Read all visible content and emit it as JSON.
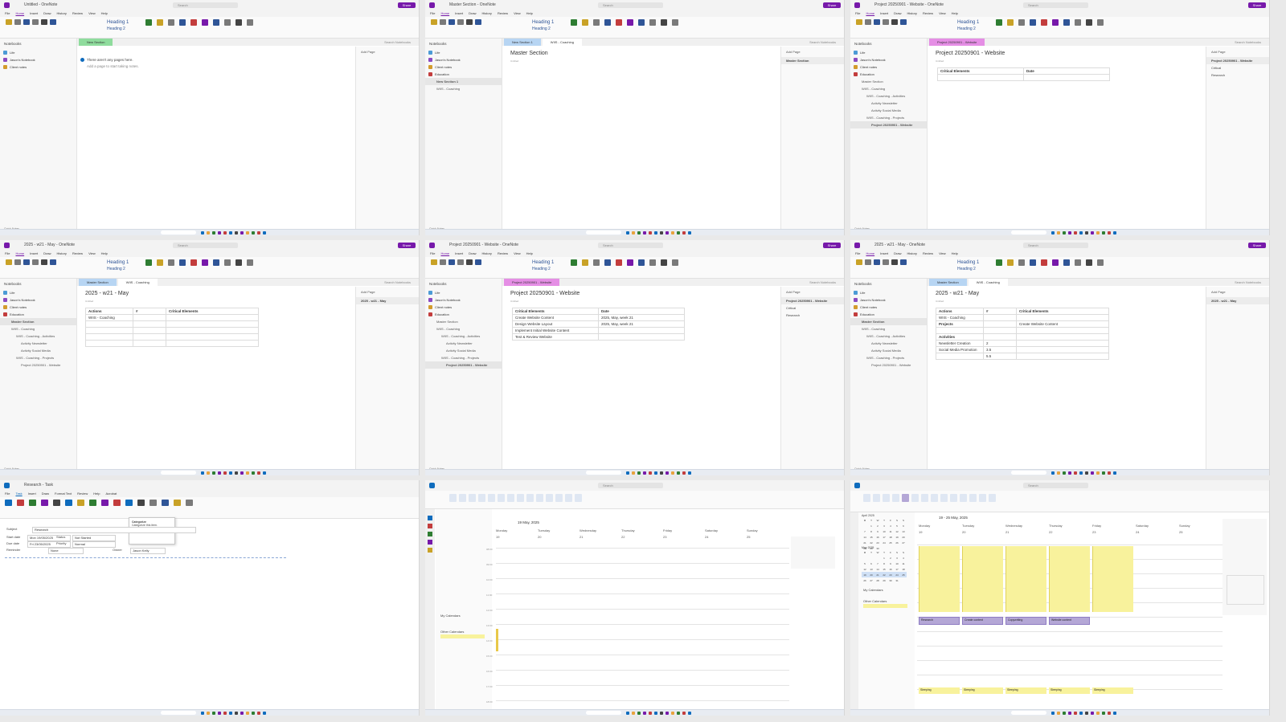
{
  "brand": {
    "onenote_purple": "#7719aa",
    "outlook_blue": "#0f6cbd",
    "event_yellow": "#f8f29c",
    "event_purple": "#b4a7d6",
    "page_tab_pink": "#e58ee5",
    "section_tab_blue": "#b7d5f3",
    "section_tab_green": "#8fdc9d"
  },
  "panels": [
    {
      "window_title": "Untitled - OneNote",
      "search": "Search",
      "share": "Share",
      "menus": [
        "File",
        "Home",
        "Insert",
        "Draw",
        "History",
        "Review",
        "View",
        "Help"
      ],
      "active_menu": "Home",
      "ribbon": {
        "heading1": "Heading 1",
        "heading2": "Heading 2"
      },
      "notebooks_header": "Notebooks",
      "notebooks": [
        {
          "label": "Life",
          "color": "#4c9bd6"
        },
        {
          "label": "Jason's Notebook",
          "color": "#8a4ac2"
        },
        {
          "label": "Client notes",
          "color": "#d39b2c"
        }
      ],
      "tabs": [
        {
          "label": "New Section",
          "color": "#8fdc9d"
        }
      ],
      "search_sections": "Search Notebooks",
      "note_line1": "There aren't any pages here.",
      "note_line2": "Add a page to start taking notes.",
      "add_page": "Add Page",
      "footer": "Quick Notes"
    },
    {
      "window_title": "Master Section - OneNote",
      "search": "Search",
      "share": "Share",
      "menus": [
        "File",
        "Home",
        "Insert",
        "Draw",
        "History",
        "Review",
        "View",
        "Help"
      ],
      "active_menu": "Home",
      "ribbon": {
        "heading1": "Heading 1",
        "heading2": "Heading 2"
      },
      "notebooks_header": "Notebooks",
      "notebooks": [
        {
          "label": "Life",
          "color": "#4c9bd6"
        },
        {
          "label": "Jason's Notebook",
          "color": "#8a4ac2"
        },
        {
          "label": "Client notes",
          "color": "#d39b2c"
        },
        {
          "label": "Education",
          "color": "#c33d3d"
        }
      ],
      "sections": [
        {
          "label": "New Section 1",
          "level": 1,
          "selected": true
        },
        {
          "label": "WIIS - Coaching",
          "level": 1,
          "selected": false
        }
      ],
      "tabs": [
        {
          "label": "New Section 1",
          "color": "#b7d5f3"
        },
        {
          "label": "WIIS - Coaching",
          "color": "#ffffff"
        }
      ],
      "search_sections": "Search Notebooks",
      "page_title": "Master Section",
      "page_date": "Untitled",
      "add_page": "Add Page",
      "pages": [
        "Master Section"
      ],
      "footer": "Quick Notes"
    },
    {
      "window_title": "Project 20250901 - Website - OneNote",
      "search": "Search",
      "share": "Share",
      "menus": [
        "File",
        "Home",
        "Insert",
        "Draw",
        "History",
        "Review",
        "View",
        "Help"
      ],
      "active_menu": "Home",
      "ribbon": {
        "heading1": "Heading 1",
        "heading2": "Heading 2"
      },
      "notebooks_header": "Notebooks",
      "notebooks": [
        {
          "label": "Life",
          "color": "#4c9bd6"
        },
        {
          "label": "Jason's Notebook",
          "color": "#8a4ac2"
        },
        {
          "label": "Client notes",
          "color": "#d39b2c"
        },
        {
          "label": "Education",
          "color": "#c33d3d"
        }
      ],
      "sections": [
        {
          "label": "Master Section",
          "level": 1,
          "selected": false
        },
        {
          "label": "WIIS - Coaching",
          "level": 1,
          "selected": false
        },
        {
          "label": "WIIS - Coaching - Activities",
          "level": 2,
          "selected": false
        },
        {
          "label": "Activity Newsletter",
          "level": 3,
          "selected": false
        },
        {
          "label": "Activity Social Media",
          "level": 3,
          "selected": false
        },
        {
          "label": "WIIS - Coaching - Projects",
          "level": 2,
          "selected": false
        },
        {
          "label": "Project 20250901 - Website",
          "level": 3,
          "selected": true
        }
      ],
      "tabs": [
        {
          "label": "Project 20250901 - Website",
          "color": "#e58ee5"
        }
      ],
      "search_sections": "Search Notebooks",
      "page_title": "Project 20250901 - Website",
      "page_date": "Untitled",
      "table": [
        [
          "Critical Elements",
          "Date"
        ],
        [
          "",
          ""
        ]
      ],
      "add_page": "Add Page",
      "pages": [
        "Project 20250901 - Website",
        "Critical",
        "Research"
      ],
      "footer": "Quick Notes"
    },
    {
      "window_title": "2025 - w21 - May - OneNote",
      "search": "Search",
      "share": "Share",
      "menus": [
        "File",
        "Home",
        "Insert",
        "Draw",
        "History",
        "Review",
        "View",
        "Help"
      ],
      "active_menu": "Home",
      "ribbon": {
        "heading1": "Heading 1",
        "heading2": "Heading 2"
      },
      "notebooks_header": "Notebooks",
      "notebooks": [
        {
          "label": "Life",
          "color": "#4c9bd6"
        },
        {
          "label": "Jason's Notebook",
          "color": "#8a4ac2"
        },
        {
          "label": "Client notes",
          "color": "#d39b2c"
        },
        {
          "label": "Education",
          "color": "#c33d3d"
        }
      ],
      "sections": [
        {
          "label": "Master Section",
          "level": 1,
          "selected": true
        },
        {
          "label": "WIIS - Coaching",
          "level": 1,
          "selected": false
        },
        {
          "label": "WIIS - Coaching - Activities",
          "level": 2,
          "selected": false
        },
        {
          "label": "Activity Newsletter",
          "level": 3,
          "selected": false
        },
        {
          "label": "Activity Social Media",
          "level": 3,
          "selected": false
        },
        {
          "label": "WIIS - Coaching - Projects",
          "level": 2,
          "selected": false
        },
        {
          "label": "Project 20250901 - Website",
          "level": 3,
          "selected": false
        }
      ],
      "tabs": [
        {
          "label": "Master Section",
          "color": "#b7d5f3"
        },
        {
          "label": "WIIS - Coaching",
          "color": "#ffffff"
        }
      ],
      "search_sections": "Search Notebooks",
      "page_title": "2025 - w21 - May",
      "page_date": "Untitled",
      "table": [
        [
          "Actions",
          "#",
          "Critical Elements"
        ],
        [
          "WIIS - Coaching",
          "",
          ""
        ],
        [
          "",
          "",
          ""
        ],
        [
          "",
          "",
          ""
        ],
        [
          "",
          "",
          ""
        ],
        [
          "",
          "",
          ""
        ]
      ],
      "add_page": "Add Page",
      "pages": [
        "2025 - w21 - May"
      ],
      "footer": "Quick Notes"
    },
    {
      "window_title": "Project 20250901 - Website - OneNote",
      "search": "Search",
      "share": "Share",
      "menus": [
        "File",
        "Home",
        "Insert",
        "Draw",
        "History",
        "Review",
        "View",
        "Help"
      ],
      "active_menu": "Home",
      "ribbon": {
        "heading1": "Heading 1",
        "heading2": "Heading 2"
      },
      "notebooks_header": "Notebooks",
      "notebooks": [
        {
          "label": "Life",
          "color": "#4c9bd6"
        },
        {
          "label": "Jason's Notebook",
          "color": "#8a4ac2"
        },
        {
          "label": "Client notes",
          "color": "#d39b2c"
        },
        {
          "label": "Education",
          "color": "#c33d3d"
        }
      ],
      "sections": [
        {
          "label": "Master Section",
          "level": 1,
          "selected": false
        },
        {
          "label": "WIIS - Coaching",
          "level": 1,
          "selected": false
        },
        {
          "label": "WIIS - Coaching - Activities",
          "level": 2,
          "selected": false
        },
        {
          "label": "Activity Newsletter",
          "level": 3,
          "selected": false
        },
        {
          "label": "Activity Social Media",
          "level": 3,
          "selected": false
        },
        {
          "label": "WIIS - Coaching - Projects",
          "level": 2,
          "selected": false
        },
        {
          "label": "Project 20250901 - Website",
          "level": 3,
          "selected": true
        }
      ],
      "tabs": [
        {
          "label": "Project 20250901 - Website",
          "color": "#e58ee5"
        }
      ],
      "search_sections": "Search Notebooks",
      "page_title": "Project 20250901 - Website",
      "page_date": "Untitled",
      "table": [
        [
          "Critical Elements",
          "Date"
        ],
        [
          "Create Website Content",
          "2025, May, week 21"
        ],
        [
          "Design Website Layout",
          "2025, May, week 21"
        ],
        [
          "Implement Initial Website Content",
          ""
        ],
        [
          "Test & Review Website",
          ""
        ]
      ],
      "add_page": "Add Page",
      "pages": [
        "Project 20250901 - Website",
        "Critical",
        "Research"
      ],
      "footer": "Quick Notes"
    },
    {
      "window_title": "2025 - w21 - May - OneNote",
      "search": "Search",
      "share": "Share",
      "menus": [
        "File",
        "Home",
        "Insert",
        "Draw",
        "History",
        "Review",
        "View",
        "Help"
      ],
      "active_menu": "Home",
      "ribbon": {
        "heading1": "Heading 1",
        "heading2": "Heading 2"
      },
      "notebooks_header": "Notebooks",
      "notebooks": [
        {
          "label": "Life",
          "color": "#4c9bd6"
        },
        {
          "label": "Jason's Notebook",
          "color": "#8a4ac2"
        },
        {
          "label": "Client notes",
          "color": "#d39b2c"
        },
        {
          "label": "Education",
          "color": "#c33d3d"
        }
      ],
      "sections": [
        {
          "label": "Master Section",
          "level": 1,
          "selected": true
        },
        {
          "label": "WIIS - Coaching",
          "level": 1,
          "selected": false
        },
        {
          "label": "WIIS - Coaching - Activities",
          "level": 2,
          "selected": false
        },
        {
          "label": "Activity Newsletter",
          "level": 3,
          "selected": false
        },
        {
          "label": "Activity Social Media",
          "level": 3,
          "selected": false
        },
        {
          "label": "WIIS - Coaching - Projects",
          "level": 2,
          "selected": false
        },
        {
          "label": "Project 20250901 - Website",
          "level": 3,
          "selected": false
        }
      ],
      "tabs": [
        {
          "label": "Master Section",
          "color": "#b7d5f3"
        },
        {
          "label": "WIIS - Coaching",
          "color": "#ffffff"
        }
      ],
      "search_sections": "Search Notebooks",
      "page_title": "2025 - w21 - May",
      "page_date": "Untitled",
      "table": [
        [
          "Actions",
          "#",
          "Critical Elements"
        ],
        [
          "WIIS - Coaching",
          "",
          ""
        ],
        [
          "Projects",
          "",
          "Create Website Content"
        ],
        [
          "",
          "",
          ""
        ],
        [
          "Activities",
          "",
          ""
        ],
        [
          "Newsletter Creation",
          "2",
          ""
        ],
        [
          "Social Media Promotion",
          "3.5",
          ""
        ],
        [
          "",
          "5.5",
          ""
        ]
      ],
      "add_page": "Add Page",
      "pages": [
        "2025 - w21 - May"
      ],
      "footer": "Quick Notes"
    }
  ],
  "outlook_task": {
    "window_title": "Research - Task",
    "menus": [
      "File",
      "Task",
      "Insert",
      "Draw",
      "Format Text",
      "Review",
      "Help",
      "Acrobat"
    ],
    "active_menu": "Task",
    "subject_label": "Subject",
    "subject": "Research",
    "start_label": "Start date",
    "start_value": "Mon 19/05/2025",
    "due_label": "Due date",
    "due_value": "Fri 23/05/2025",
    "reminder_label": "Reminder",
    "reminder_value": "None",
    "status_label": "Status",
    "status_value": "Not Started",
    "priority_label": "Priority",
    "priority_value": "Normal",
    "complete_label": "% Complete",
    "complete_value": "0%",
    "owner_label": "Owner",
    "owner_value": "Jason Kelly",
    "tooltip_title": "Categorize",
    "tooltip_body": "Categorize this item."
  },
  "outlook_calendar_1": {
    "search": "Search",
    "date_range": "19 May, 2025",
    "days": [
      {
        "name": "Monday",
        "num": "19"
      },
      {
        "name": "Tuesday",
        "num": "20"
      },
      {
        "name": "Wednesday",
        "num": "21"
      },
      {
        "name": "Thursday",
        "num": "22"
      },
      {
        "name": "Friday",
        "num": "23"
      },
      {
        "name": "Saturday",
        "num": "24"
      },
      {
        "name": "Sunday",
        "num": "25"
      }
    ],
    "hours": [
      "08:00",
      "09:00",
      "10:00",
      "11:00",
      "12:00",
      "13:00",
      "14:00",
      "15:00",
      "16:00",
      "17:00",
      "18:00"
    ],
    "folders": [
      "My Calendars",
      "Other Calendars"
    ]
  },
  "outlook_calendar_2": {
    "search": "Search",
    "date_range": "19 - 25 May, 2025",
    "days": [
      {
        "name": "Monday",
        "num": "19"
      },
      {
        "name": "Tuesday",
        "num": "20"
      },
      {
        "name": "Wednesday",
        "num": "21"
      },
      {
        "name": "Thursday",
        "num": "22"
      },
      {
        "name": "Friday",
        "num": "23"
      },
      {
        "name": "Saturday",
        "num": "24"
      },
      {
        "name": "Sunday",
        "num": "25"
      }
    ],
    "mini_month_1": "April 2025",
    "mini_month_2": "May 2025",
    "weekday_initials": [
      "M",
      "T",
      "W",
      "T",
      "F",
      "S",
      "S"
    ],
    "folders": [
      "My Calendars",
      "Other Calendars"
    ],
    "purple_events": [
      "Research",
      "Create content",
      "Copywriting",
      "Website content"
    ],
    "bottom_events": [
      "Sleeping",
      "Sleeping",
      "Sleeping",
      "Sleeping",
      "Sleeping"
    ]
  }
}
